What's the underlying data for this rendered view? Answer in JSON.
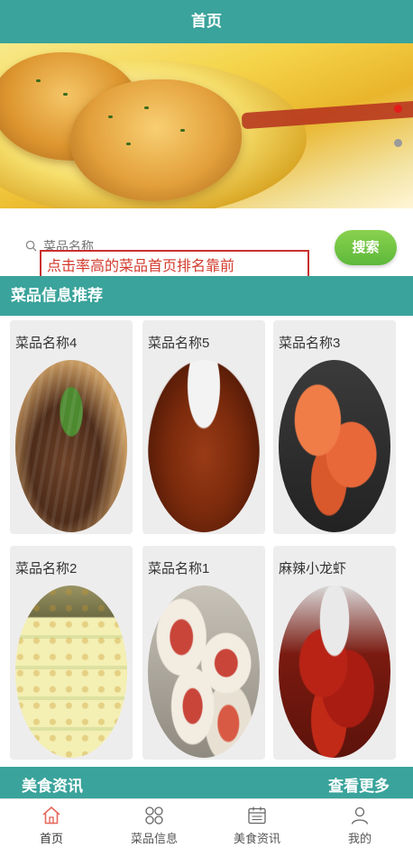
{
  "header": {
    "title": "首页"
  },
  "banner": {
    "slide_count": 2,
    "active_slide": 1
  },
  "search": {
    "placeholder": "菜品名称",
    "button_label": "搜索"
  },
  "notice": {
    "text": "点击率高的菜品首页排名靠前"
  },
  "recommend": {
    "title": "菜品信息推荐",
    "items": [
      {
        "name": "菜品名称4",
        "image": "beef-dish"
      },
      {
        "name": "菜品名称5",
        "image": "braised-fish-dish"
      },
      {
        "name": "菜品名称3",
        "image": "shrimp-dish"
      },
      {
        "name": "菜品名称2",
        "image": "tofu-dessert"
      },
      {
        "name": "菜品名称1",
        "image": "oyster-dish"
      },
      {
        "name": "麻辣小龙虾",
        "image": "spicy-crayfish-dish"
      }
    ]
  },
  "news": {
    "title": "美食资讯",
    "more_label": "查看更多"
  },
  "tabbar": {
    "items": [
      {
        "label": "首页",
        "icon": "home-icon",
        "active": true
      },
      {
        "label": "菜品信息",
        "icon": "grid-icon",
        "active": false
      },
      {
        "label": "美食资讯",
        "icon": "calendar-icon",
        "active": false
      },
      {
        "label": "我的",
        "icon": "user-icon",
        "active": false
      }
    ]
  },
  "colors": {
    "primary": "#3aa39b",
    "search_button": "#6cc24a",
    "notice_border": "#c8302f",
    "active_dot": "#e51c1c"
  }
}
